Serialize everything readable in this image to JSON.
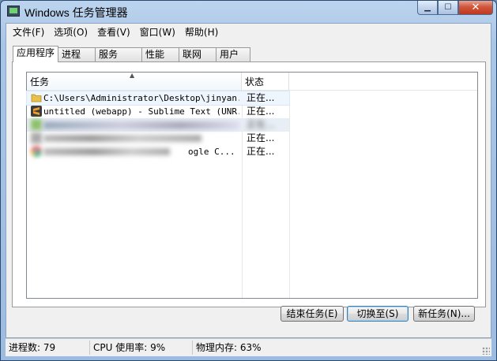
{
  "window": {
    "title": "Windows 任务管理器"
  },
  "menu": [
    "文件(F)",
    "选项(O)",
    "查看(V)",
    "窗口(W)",
    "帮助(H)"
  ],
  "tabs": [
    "应用程序",
    "进程",
    "服务",
    "性能",
    "联网",
    "用户"
  ],
  "list": {
    "columns": {
      "task": "任务",
      "status": "状态"
    },
    "rows": [
      {
        "icon": "folder-icon",
        "name": "C:\\Users\\Administrator\\Desktop\\jinyan...",
        "status": "正在..."
      },
      {
        "icon": "sublime-text-icon",
        "name": "untitled (webapp) - Sublime Text (UNR...",
        "status": "正在..."
      },
      {
        "icon": "blurred-app-icon",
        "name": "",
        "status": "正在..."
      },
      {
        "icon": "blurred-app-icon",
        "name": "",
        "status": "正在..."
      },
      {
        "icon": "chrome-icon",
        "name": "ogle C...",
        "status": "正在..."
      }
    ]
  },
  "buttons": {
    "end_task": "结束任务(E)",
    "switch_to": "切换至(S)",
    "new_task": "新任务(N)..."
  },
  "statusbar": {
    "processes": "进程数: 79",
    "cpu": "CPU 使用率: 9%",
    "memory": "物理内存: 63%"
  }
}
